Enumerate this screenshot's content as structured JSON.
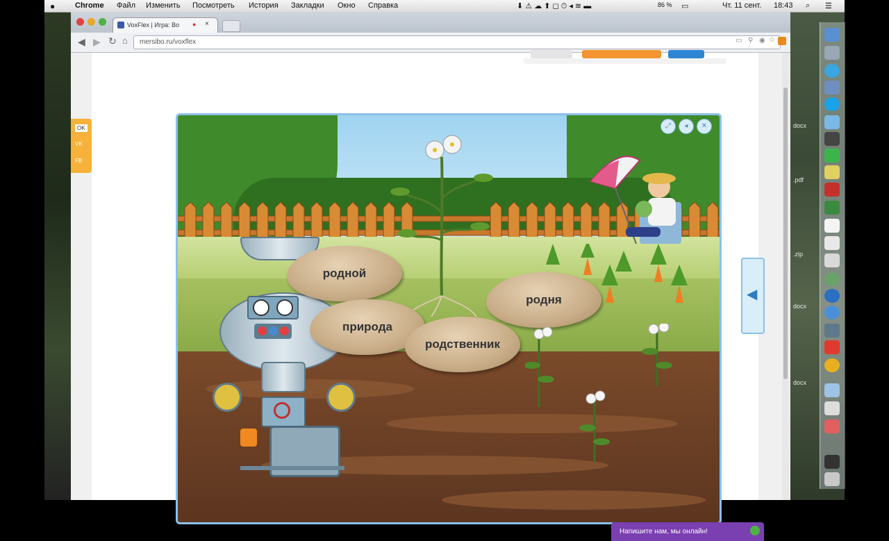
{
  "menubar": {
    "app": "Chrome",
    "items": [
      "Файл",
      "Изменить",
      "Посмотреть",
      "История",
      "Закладки",
      "Окно",
      "Справка"
    ],
    "battery": "86 %",
    "date": "Чт. 11 сент.",
    "time": "18:43"
  },
  "browser": {
    "tab_title": "VoxFlex | Игра: Во",
    "url": "mersibo.ru/voxflex"
  },
  "social": {
    "items": [
      "OK",
      "VK",
      "FB"
    ]
  },
  "game": {
    "words": [
      "родной",
      "природа",
      "родственник",
      "родня"
    ]
  },
  "chat": {
    "label": "Напишите нам, мы онлайн!"
  },
  "desktop": {
    "files": [
      ".pdf",
      "docx",
      ".zip",
      "docx",
      "docx"
    ]
  },
  "colors": {
    "frame": "#8cc0e8",
    "chat": "#7a3fb0",
    "social": "#f6b23a"
  }
}
